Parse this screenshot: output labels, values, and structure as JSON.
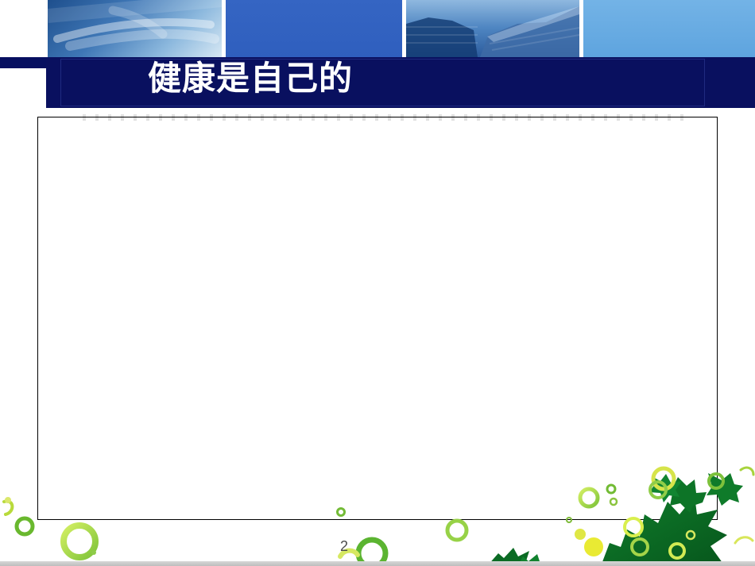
{
  "slide": {
    "title": "健康是自己的",
    "page_number": "2"
  }
}
